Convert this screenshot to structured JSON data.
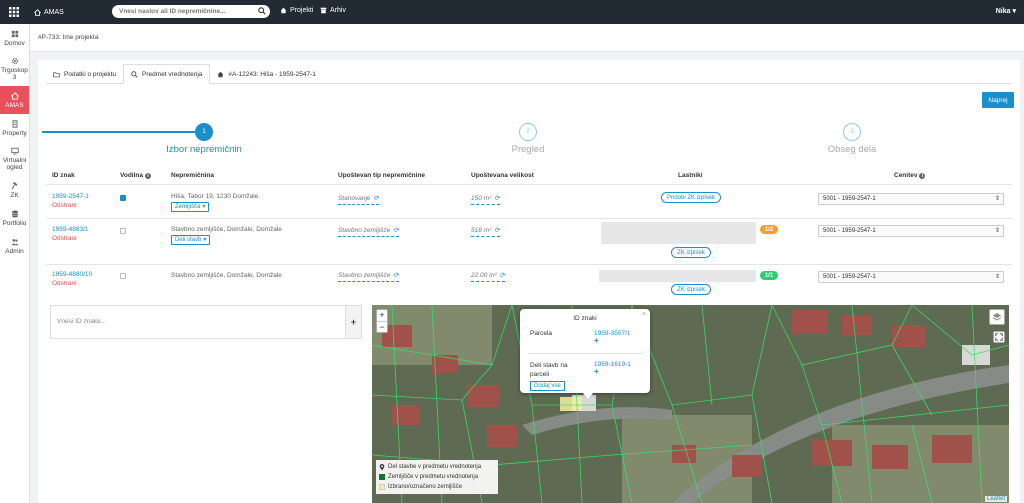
{
  "topbar": {
    "brand": "AMAS",
    "search_placeholder": "Vnesi naslov ali ID nepremičnine...",
    "link_projekti": "Projekti",
    "link_arhiv": "Arhiv",
    "user": "Nika"
  },
  "sidebar": {
    "items": [
      {
        "label": "Domov"
      },
      {
        "label": "Trgoskop 3"
      },
      {
        "label": "AMAS"
      },
      {
        "label": "Property"
      },
      {
        "label": "Virtualni ogled"
      },
      {
        "label": "ZK"
      },
      {
        "label": "Portfolio"
      },
      {
        "label": "Admin"
      }
    ]
  },
  "breadcrumb": "#P-733: Ime projekta",
  "tabs": [
    {
      "label": "Podatki o projektu"
    },
    {
      "label": "Predmet vrednotenja"
    },
    {
      "label": "#A-12243: Hiša - 1959-2547-1"
    }
  ],
  "next_button": "Naprej",
  "steps": [
    {
      "label": "Izbor nepremičnin",
      "number": "1",
      "state": "done"
    },
    {
      "label": "Pregled",
      "number": "2",
      "state": "todo"
    },
    {
      "label": "Obseg dela",
      "number": "3",
      "state": "todo"
    }
  ],
  "colors": {
    "accent": "#1a8fcc",
    "danger": "#e05050",
    "orange": "#f0a030",
    "green": "#2ecc71",
    "active_side": "#e8505b"
  },
  "table": {
    "headers": {
      "id": "ID znak",
      "lead": "Vodilna",
      "property": "Nepremičnina",
      "type": "Upoštevan tip nepremičnine",
      "size": "Upoštevana velikost",
      "owners": "Lastniki",
      "appraiser": "Cenitev"
    },
    "rows": [
      {
        "id": "1959-2547-1",
        "remove": "Odstrani",
        "lead": true,
        "address": "Hiša, Tabor 19, 1230 Domžale",
        "tag": "Zemljišča",
        "type": "Stanovanje",
        "size": "150 m²",
        "owner_button": "Pridobi ZK izpisek",
        "badge": "",
        "cenitev": "5001 - 1959-2547-1"
      },
      {
        "id": "1959-4883/1",
        "remove": "Odstrani",
        "lead": false,
        "address": "Stavbno zemljišče, Domžale, Domžale",
        "tag": "Deli stavb",
        "type": "Stavbno zemljišče",
        "size": "518 m²",
        "owner_button": "ZK izpisek",
        "badge": "1/2",
        "cenitev": "5001 - 1959-2547-1"
      },
      {
        "id": "1959-4880/10",
        "remove": "Odstrani",
        "lead": false,
        "address": "Stavbno zemljišče, Domžale, Domžale",
        "tag": "",
        "type": "Stavbno zemljišče",
        "size": "22.00 m²",
        "owner_button": "ZK izpisek",
        "badge": "1/1",
        "cenitev": "5001 - 1959-2547-1"
      }
    ]
  },
  "id_input_placeholder": "Vnesi ID znake...",
  "map": {
    "popup": {
      "title": "ID znaki",
      "parcela_label": "Parcela",
      "parcela_value": "1959-3507/1",
      "deli_label_1": "Deli stavb na",
      "deli_label_2": "parceli",
      "deli_value": "1959-1619-1",
      "add_all": "Dodaj vse"
    },
    "legend": [
      {
        "label": "Del stavbe v predmetu vrednotenja",
        "icon": "map-pin-icon"
      },
      {
        "label": "Zemljišče v predmetu vrednotenja",
        "color": "#0c7a2c"
      },
      {
        "label": "Izbrano/označeno zemljišče",
        "color": "#f5f0a0"
      }
    ],
    "attribution": "Leaflet"
  }
}
